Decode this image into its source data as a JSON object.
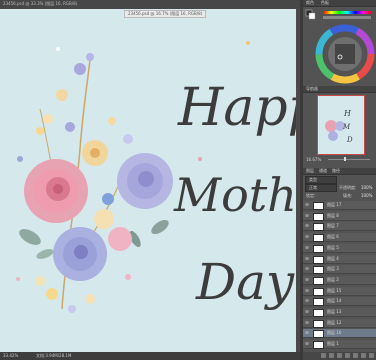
{
  "document": {
    "tab_title": "23456.psd @ 33.3% (图层 16, RGB/8)",
    "floating_title": "23456.psd @ 16.7% (图层 16, RGB/8)",
    "status_zoom": "33.42%",
    "status_doc": "文档:3.94M/28.1M",
    "artwork": {
      "line1": "Happy",
      "line2": "Mother's",
      "line3": "Day"
    }
  },
  "panels": {
    "color_tab": "颜色",
    "swatch_tab": "色板",
    "navigator_tab": "导航器",
    "navigator_zoom": "16.67%",
    "layers_tabs": [
      "图层",
      "通道",
      "路径"
    ],
    "layers_search": "类型",
    "blend_mode": "正常",
    "opacity_label": "不透明度:",
    "opacity_value": "100%",
    "fill_label": "填充:",
    "fill_value": "100%",
    "lock_label": "锁定:"
  },
  "layers": [
    {
      "name": "图层 17",
      "selected": false
    },
    {
      "name": "图层 8",
      "selected": false
    },
    {
      "name": "图层 7",
      "selected": false
    },
    {
      "name": "图层 6",
      "selected": false
    },
    {
      "name": "图层 5",
      "selected": false
    },
    {
      "name": "图层 4",
      "selected": false
    },
    {
      "name": "图层 3",
      "selected": false
    },
    {
      "name": "图层 2",
      "selected": false
    },
    {
      "name": "图层 15",
      "selected": false
    },
    {
      "name": "图层 14",
      "selected": false
    },
    {
      "name": "图层 13",
      "selected": false
    },
    {
      "name": "图层 12",
      "selected": false
    },
    {
      "name": "图层 16",
      "selected": true
    },
    {
      "name": "图层 1",
      "selected": false
    }
  ],
  "icons": [
    "eye-icon",
    "color-wheel-icon",
    "navigator-preview-icon"
  ],
  "colors": {
    "canvas": "#d5e8ec",
    "panel": "#535353",
    "selected": "#6d7b8a"
  }
}
